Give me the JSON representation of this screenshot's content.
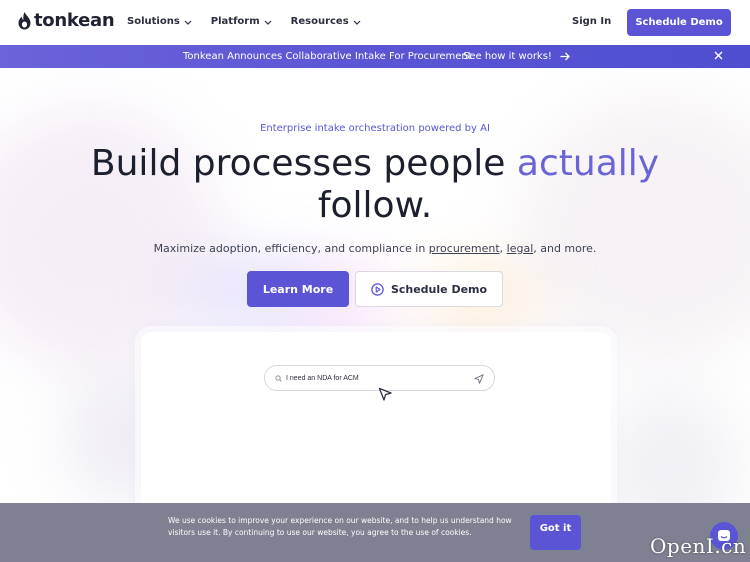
{
  "brand": {
    "name": "tonkean",
    "accent_color": "#5b55d6"
  },
  "nav": {
    "menu": [
      {
        "label": "Solutions"
      },
      {
        "label": "Platform"
      },
      {
        "label": "Resources"
      }
    ],
    "sign_in": "Sign In",
    "cta": "Schedule Demo"
  },
  "announcement": {
    "text": "Tonkean Announces Collaborative Intake For Procurement",
    "link": "See how it works!",
    "close_icon": "close-icon"
  },
  "hero": {
    "eyebrow": "Enterprise intake orchestration powered by AI",
    "headline_part1": "Build processes people ",
    "headline_accent": "actually",
    "headline_part2": "follow.",
    "sub_prefix": "Maximize adoption, efficiency, and compliance in ",
    "sub_link1": "procurement",
    "sub_sep": ", ",
    "sub_link2": "legal",
    "sub_suffix": ", and more.",
    "primary_button": "Learn More",
    "secondary_button": "Schedule Demo"
  },
  "product_preview": {
    "search_value": "I need an NDA for ACM",
    "search_icon": "search-icon",
    "send_icon": "send-icon"
  },
  "cookie_banner": {
    "text": "We use cookies to improve your experience on our website, and to help us understand how visitors use it. By continuing to use our website, you agree to the use of cookies.",
    "button": "Got it"
  },
  "watermark": "OpenI.cn"
}
